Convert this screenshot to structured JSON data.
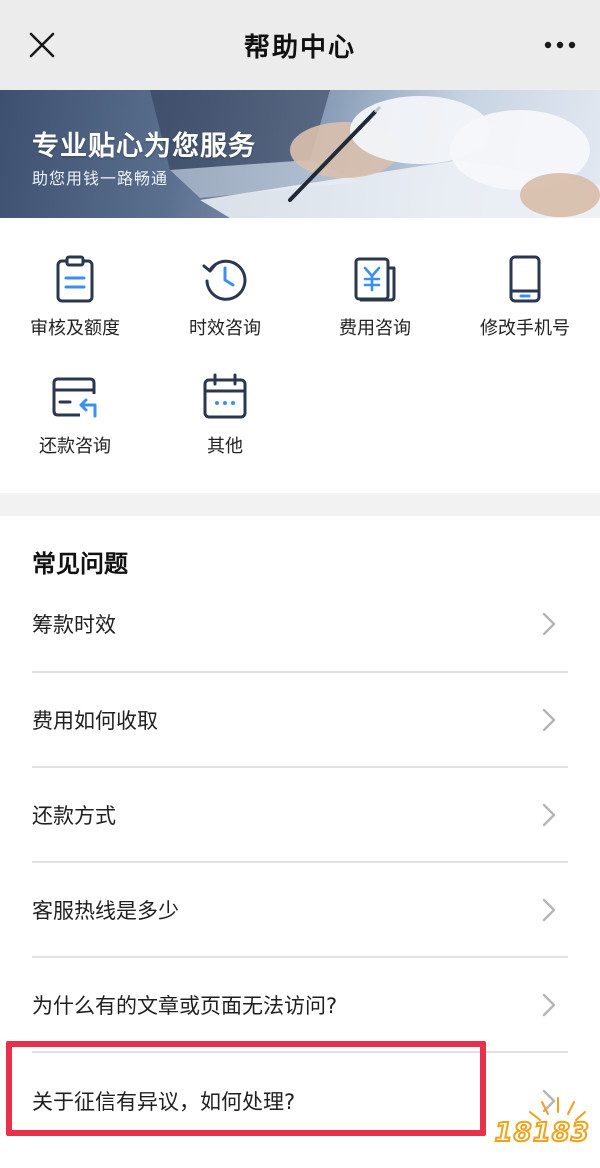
{
  "navbar": {
    "title": "帮助中心",
    "close_icon": "close-icon",
    "more_icon": "more-dots-icon"
  },
  "banner": {
    "title": "专业贴心为您服务",
    "subtitle": "助您用钱一路畅通"
  },
  "categories": [
    {
      "label": "审核及额度",
      "icon": "clipboard-icon"
    },
    {
      "label": "时效咨询",
      "icon": "clock-history-icon"
    },
    {
      "label": "费用咨询",
      "icon": "yuan-document-icon"
    },
    {
      "label": "修改手机号",
      "icon": "smartphone-icon"
    },
    {
      "label": "还款咨询",
      "icon": "card-return-icon"
    },
    {
      "label": "其他",
      "icon": "calendar-dots-icon"
    }
  ],
  "faq": {
    "heading": "常见问题",
    "items": [
      "筹款时效",
      "费用如何收取",
      "还款方式",
      "客服热线是多少",
      "为什么有的文章或页面无法访问?",
      "关于征信有异议，如何处理?"
    ]
  },
  "watermark": {
    "text": "18183"
  },
  "colors": {
    "icon_dark": "#2b3650",
    "icon_accent": "#3a8ff0",
    "highlight": "#e8304b",
    "divider": "#e2e2e2"
  }
}
